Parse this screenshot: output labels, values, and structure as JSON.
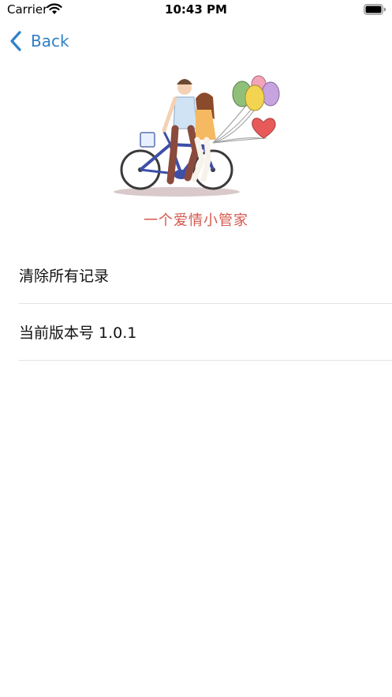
{
  "status_bar": {
    "carrier": "Carrier",
    "time": "10:43 PM",
    "wifi_icon": "wifi-icon",
    "battery_icon": "battery-icon"
  },
  "nav": {
    "back_label": "Back",
    "back_icon": "chevron-left-icon",
    "accent_color": "#2f7fc8"
  },
  "header": {
    "illustration": "couple-on-bicycle-with-balloons",
    "slogan": "一个爱情小管家",
    "slogan_color": "#d6574c"
  },
  "settings": {
    "items": [
      {
        "label": "清除所有记录"
      },
      {
        "label": "当前版本号 1.0.1"
      }
    ]
  }
}
